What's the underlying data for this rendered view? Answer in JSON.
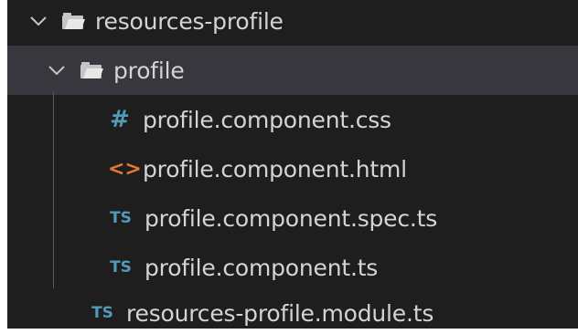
{
  "tree": {
    "root_folder": {
      "label": "resources-profile",
      "expanded": true,
      "chevron_icon": "chevron-down-icon",
      "folder_icon": "folder-open-icon"
    },
    "sub_folder": {
      "label": "profile",
      "expanded": true,
      "selected": true,
      "chevron_icon": "chevron-down-icon",
      "folder_icon": "folder-open-icon"
    },
    "files": [
      {
        "label": "profile.component.css",
        "icon_text": "#",
        "icon": "css-file-icon",
        "color": "#519aba"
      },
      {
        "label": "profile.component.html",
        "icon_text": "<>",
        "icon": "html-file-icon",
        "color": "#e37933"
      },
      {
        "label": "profile.component.spec.ts",
        "icon_text": "TS",
        "icon": "typescript-file-icon",
        "color": "#519aba"
      },
      {
        "label": "profile.component.ts",
        "icon_text": "TS",
        "icon": "typescript-file-icon",
        "color": "#519aba"
      }
    ],
    "module_file": {
      "label": "resources-profile.module.ts",
      "icon_text": "TS",
      "icon": "typescript-file-icon",
      "color": "#519aba"
    }
  },
  "colors": {
    "background": "#1e1e1e",
    "selected_row": "#37373d",
    "text": "#d4d4d4",
    "ts_blue": "#519aba",
    "html_orange": "#e37933"
  }
}
